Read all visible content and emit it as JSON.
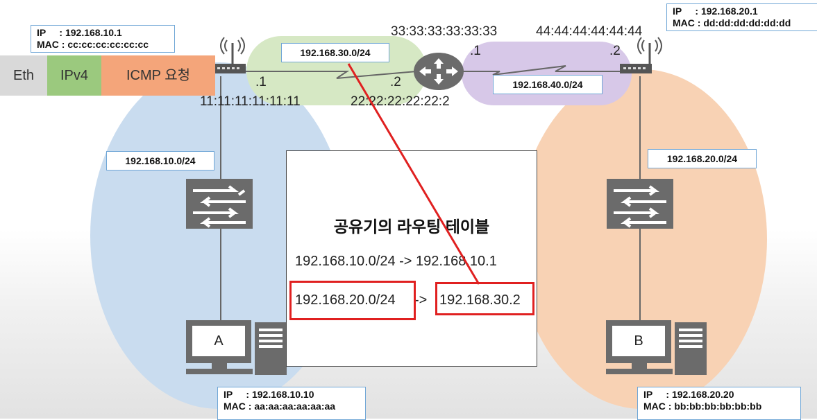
{
  "packet": {
    "eth": "Eth",
    "ipv4": "IPv4",
    "icmp": "ICMP 요청"
  },
  "router_left": {
    "ip": "IP     : 192.168.10.1",
    "mac": "MAC : cc:cc:cc:cc:cc:cc",
    "port1": ".1",
    "mac_port1": "11:11:11:11:11:11"
  },
  "router_right": {
    "ip": "IP     : 192.168.20.1",
    "mac": "MAC : dd:dd:dd:dd:dd:dd",
    "port2": ".2",
    "mac_port2": "44:44:44:44:44:44"
  },
  "center_router": {
    "mac_left": "33:33:33:33:33:33",
    "port_left": ".2",
    "mac_bottom": "22:22:22:22:22:2",
    "port_right": ".1"
  },
  "networks": {
    "net30": "192.168.30.0/24",
    "net40": "192.168.40.0/24",
    "net10": "192.168.10.0/24",
    "net20": "192.168.20.0/24"
  },
  "routing_table": {
    "title": "공유기의 라우팅 테이블",
    "row1": "192.168.10.0/24 -> 192.168.10.1",
    "row2_dest": "192.168.20.0/24",
    "row2_arrow": "->",
    "row2_next": "192.168.30.2"
  },
  "host_a": {
    "label": "A",
    "ip": "IP     : 192.168.10.10",
    "mac": "MAC : aa:aa:aa:aa:aa:aa"
  },
  "host_b": {
    "label": "B",
    "ip": "IP     : 192.168.20.20",
    "mac": "MAC : bb:bb:bb:bb:bb:bb"
  },
  "colors": {
    "highlight": "#e02020",
    "blue_zone": "#c9dcef",
    "orange_zone": "#f8d2b4",
    "green_zone": "#d6e8c4",
    "purple_zone": "#d7c8e8"
  }
}
